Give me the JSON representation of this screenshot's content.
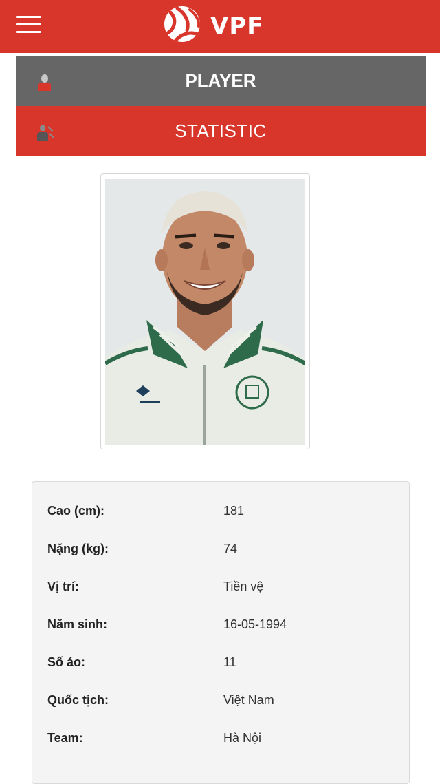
{
  "header": {
    "logo_text": "VPF",
    "menu_icon": "hamburger-menu-icon",
    "background_color": "#d8352b"
  },
  "tabs": [
    {
      "label": "PLAYER",
      "icon": "player-silhouette-icon",
      "color": "#666666"
    },
    {
      "label": "STATISTIC",
      "icon": "statistic-player-icon",
      "color": "#d8352b"
    }
  ],
  "player": {
    "photo_icon": "player-portrait",
    "info": [
      {
        "label": "Cao (cm):",
        "value": "181"
      },
      {
        "label": "Nặng (kg):",
        "value": "74"
      },
      {
        "label": "Vị trí:",
        "value": "Tiền vệ"
      },
      {
        "label": "Năm sinh:",
        "value": "16-05-1994"
      },
      {
        "label": "Số áo:",
        "value": "11"
      },
      {
        "label": "Quốc tịch:",
        "value": "Việt Nam"
      },
      {
        "label": "Team:",
        "value": "Hà Nội"
      }
    ]
  }
}
